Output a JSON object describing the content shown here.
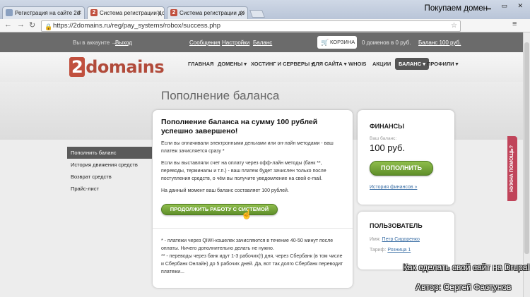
{
  "browser": {
    "tabs": [
      {
        "label": "Регистрация на сайте 2d",
        "favicon": "2"
      },
      {
        "label": "Система регистрации до",
        "favicon": "2"
      },
      {
        "label": "Система регистрации до",
        "favicon": "2"
      }
    ],
    "url": "https://2domains.ru/reg/pay_systems/robox/success.php",
    "channel_text": "Покупаем домен"
  },
  "site": {
    "topbar": {
      "account_text": "Вы в аккаунте →",
      "logout": "Выход",
      "messages": "Сообщения",
      "settings": "Настройки",
      "balance_link": "Баланс",
      "cart": "КОРЗИНА",
      "cart_status": "0 доменов в 0 руб.",
      "balance_amount": "Баланс 100 руб."
    },
    "logo": {
      "prefix": "2",
      "name": "domains"
    },
    "menu": [
      "ГЛАВНАЯ",
      "ДОМЕНЫ",
      "ХОСТИНГ И СЕРВЕРЫ",
      "ДЛЯ САЙТА",
      "WHOIS",
      "АКЦИИ",
      "БАЛАНС",
      "ПРОФИЛИ"
    ],
    "page_title": "Пополнение баланса",
    "sidebar": [
      {
        "label": "Пополнить баланс"
      },
      {
        "label": "История движения средств"
      },
      {
        "label": "Возврат средств"
      },
      {
        "label": "Прайс-лист"
      }
    ],
    "main": {
      "heading_line1": "Пополнение баланса на сумму 100 рублей",
      "heading_line2": "успешно завершено!",
      "p1": "Если вы оплачивали электронными деньгами или он-лайн методами - ваш платеж зачисляется сразу *",
      "p2": "Если вы выставляли счет на оплату через офф-лайн методы (банк **, переводы, терминалы и т.п.) - ваш платеж будет зачислен только после поступления средств, о чём вы получите уведомление на свой e-mail.",
      "p3": "На данный момент ваш баланс составляет 100 рублей.",
      "continue_button": "ПРОДОЛЖИТЬ РАБОТУ С СИСТЕМОЙ",
      "note1": "* - платежи через QIWI-кошелек зачисляются в течение 40-50 минут после оплаты. Ничего дополнительно делать не нужно.",
      "note2": "** - переводы через банк идут 1-3 рабочих(!) дня, через Сбербанк (в том числе и Сбербанк Онлайн) до 5 рабочих дней. Да, вот так долго Сбербанк переводит платежи..."
    },
    "finances": {
      "title": "ФИНАНСЫ",
      "balance_label": "Ваш баланс:",
      "balance_value": "100 руб.",
      "topup_button": "ПОПОЛНИТЬ",
      "history_link": "История финансов »"
    },
    "user": {
      "title": "ПОЛЬЗОВАТЕЛЬ",
      "name_label": "Имя:",
      "name_value": "Петр Сидоренко",
      "tariff_label": "Тариф:",
      "tariff_value": "Розница 1"
    },
    "help_tab": "НУЖНА ПОМОЩЬ?"
  },
  "overlay": {
    "line1": "Как сделать свой сайт на Drupal",
    "line2": "Автор: Сергей Фастунов"
  }
}
